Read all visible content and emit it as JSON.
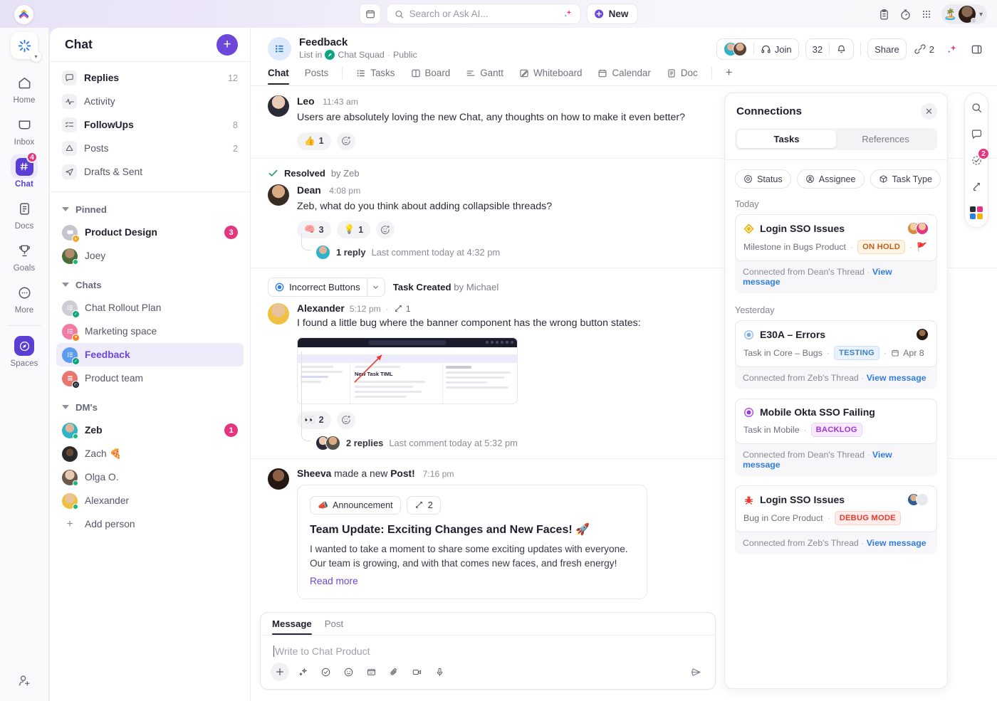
{
  "topbar": {
    "search_placeholder": "Search or Ask AI...",
    "new_label": "New",
    "icons": [
      "calendar-icon",
      "search-icon",
      "ai-sparkle-icon",
      "clipboard-icon",
      "timer-icon",
      "apps-grid-icon"
    ],
    "status_emoji": "🏝️"
  },
  "rail": {
    "items": [
      {
        "label": "Home",
        "icon": "home-icon",
        "badge": ""
      },
      {
        "label": "Inbox",
        "icon": "inbox-icon",
        "badge": ""
      },
      {
        "label": "Chat",
        "icon": "hash-icon",
        "badge": "4"
      },
      {
        "label": "Docs",
        "icon": "docs-icon",
        "badge": ""
      },
      {
        "label": "Goals",
        "icon": "trophy-icon",
        "badge": ""
      },
      {
        "label": "More",
        "icon": "more-dots-icon",
        "badge": ""
      },
      {
        "label": "Spaces",
        "icon": "compass-icon",
        "badge": ""
      }
    ],
    "invite_icon": "add-person-icon"
  },
  "sidebar": {
    "title": "Chat",
    "add_button": "+",
    "quick": [
      {
        "label": "Replies",
        "count": "12",
        "icon": "reply-bubble-icon",
        "bold": true
      },
      {
        "label": "Activity",
        "count": "",
        "icon": "activity-pulse-icon",
        "bold": false
      },
      {
        "label": "FollowUps",
        "count": "8",
        "icon": "checklist-icon",
        "bold": true
      },
      {
        "label": "Posts",
        "count": "2",
        "icon": "post-icon",
        "bold": false
      },
      {
        "label": "Drafts & Sent",
        "count": "",
        "icon": "send-icon",
        "bold": false
      }
    ],
    "sections": [
      {
        "name": "Pinned",
        "items": [
          {
            "label": "Product Design",
            "badge": "3",
            "bold": true,
            "kind": "chat",
            "color": "#b9b9c4",
            "corner": "#f5a623"
          },
          {
            "label": "Joey",
            "badge": "",
            "bold": false,
            "kind": "person",
            "color": "#7c9a6a",
            "online": true
          }
        ]
      },
      {
        "name": "Chats",
        "items": [
          {
            "label": "Chat Rollout Plan",
            "badge": "",
            "bold": false,
            "kind": "list",
            "color": "#c9c9d2",
            "corner": "#10a37f"
          },
          {
            "label": "Marketing space",
            "badge": "",
            "bold": false,
            "kind": "list",
            "color": "#f27ba6",
            "corner": "#f5821f"
          },
          {
            "label": "Feedback",
            "badge": "",
            "bold": false,
            "kind": "list",
            "color": "#5b9bf0",
            "corner": "#10a37f",
            "selected": true
          },
          {
            "label": "Product team",
            "badge": "",
            "bold": false,
            "kind": "list",
            "color": "#e8756e",
            "corner": "#1f1f2e"
          }
        ]
      },
      {
        "name": "DM's",
        "items": [
          {
            "label": "Zeb",
            "badge": "1",
            "bold": true,
            "kind": "person",
            "color": "#2fb3c9",
            "online": true
          },
          {
            "label": "Zach 🍕",
            "badge": "",
            "bold": false,
            "kind": "person",
            "color": "#3a3a3a",
            "online": false
          },
          {
            "label": "Olga O.",
            "badge": "",
            "bold": false,
            "kind": "person",
            "color": "#c8b6a6",
            "online": true
          },
          {
            "label": "Alexander",
            "badge": "",
            "bold": false,
            "kind": "person",
            "color": "#f0c040",
            "online": true
          }
        ]
      }
    ],
    "add_person": "Add person"
  },
  "channel": {
    "name": "Feedback",
    "breadcrumb_prefix": "List in",
    "space": "Chat Squad",
    "visibility": "Public",
    "separator": "·",
    "join_label": "Join",
    "notif_count": "32",
    "share_label": "Share",
    "connections_count": "2",
    "tabs": [
      {
        "label": "Chat",
        "active": true,
        "icon": ""
      },
      {
        "label": "Posts",
        "active": false,
        "icon": ""
      },
      {
        "label": "Tasks",
        "active": false,
        "icon": "list-icon"
      },
      {
        "label": "Board",
        "active": false,
        "icon": "board-icon"
      },
      {
        "label": "Gantt",
        "active": false,
        "icon": "gantt-icon"
      },
      {
        "label": "Whiteboard",
        "active": false,
        "icon": "whiteboard-icon"
      },
      {
        "label": "Calendar",
        "active": false,
        "icon": "calendar-icon"
      },
      {
        "label": "Doc",
        "active": false,
        "icon": "doc-icon"
      }
    ],
    "add_tab": "+"
  },
  "messages": [
    {
      "author": "Leo",
      "time": "11:43 am",
      "text": "Users are absolutely loving the new Chat, any thoughts on how to make it even better?",
      "avatar_color": "#d8c3ae",
      "reactions": [
        {
          "emoji": "👍",
          "count": "1"
        }
      ]
    },
    {
      "resolved_label": "Resolved",
      "resolved_by": "by Zeb",
      "author": "Dean",
      "time": "4:08 pm",
      "text": "Zeb, what do you think about adding collapsible threads?",
      "avatar_color": "#6b5141",
      "reactions": [
        {
          "emoji": "🧠",
          "count": "3"
        },
        {
          "emoji": "💡",
          "count": "1"
        }
      ],
      "thread": {
        "count": "1 reply",
        "meta": "Last comment today at 4:32 pm"
      }
    },
    {
      "task_chip": "Incorrect Buttons",
      "task_meta_bold": "Task Created",
      "task_meta_rest": "by Michael",
      "author": "Alexander",
      "time": "5:12 pm",
      "link_count": "1",
      "text": "I found a little bug where the banner component has the wrong button states:",
      "avatar_color": "#f0c040",
      "has_image": true,
      "reactions": [
        {
          "emoji": "👀",
          "count": "2"
        }
      ],
      "thread": {
        "count": "2 replies",
        "meta": "Last comment today at 5:32 pm"
      }
    },
    {
      "author": "Sheeva",
      "post_prefix": "made a new",
      "post_word": "Post!",
      "time": "7:16 pm",
      "avatar_color": "#3b2a22",
      "post": {
        "tag": "Announcement",
        "tag_emoji": "📣",
        "link_count": "2",
        "title": "Team Update: Exciting Changes and New Faces! 🚀",
        "body": "I wanted to take a moment to share some exciting updates with everyone. Our team is growing, and with that comes new faces, and fresh energy!",
        "read_more": "Read more"
      }
    }
  ],
  "composer": {
    "tabs": [
      {
        "label": "Message",
        "active": true
      },
      {
        "label": "Post",
        "active": false
      }
    ],
    "placeholder": "Write to Chat Product",
    "tools": [
      "plus-icon",
      "ai-sparkle-icon",
      "task-check-icon",
      "emoji-icon",
      "gif-icon",
      "attach-icon",
      "video-icon",
      "mic-icon"
    ],
    "send_icon": "send-icon"
  },
  "connections": {
    "title": "Connections",
    "close_icon": "close-icon",
    "tabs": [
      {
        "label": "Tasks",
        "active": true
      },
      {
        "label": "References",
        "active": false
      }
    ],
    "filters": [
      {
        "label": "Status",
        "icon": "status-circle-icon"
      },
      {
        "label": "Assignee",
        "icon": "assignee-icon"
      },
      {
        "label": "Task Type",
        "icon": "cube-icon"
      }
    ],
    "groups": [
      {
        "day": "Today",
        "cards": [
          {
            "title": "Login SSO Issues",
            "type_icon": "milestone-diamond-icon",
            "type_color": "#f2b307",
            "location": "Milestone in Bugs Product",
            "badge": "ON HOLD",
            "badge_color": "#c0621a",
            "badge_bg": "#fdf3e4",
            "badge_border": "#f3ddb8",
            "flag": "🚩",
            "date": "",
            "avatars": [
              "#e09b5b",
              "#e5357f"
            ],
            "footer": "Connected from Dean's Thread",
            "footer_sep": "·",
            "link": "View message"
          }
        ]
      },
      {
        "day": "Yesterday",
        "cards": [
          {
            "title": "E30A – Errors",
            "type_icon": "task-circle-icon",
            "type_color": "#7aa9e8",
            "location": "Task in Core – Bugs",
            "badge": "TESTING",
            "badge_color": "#3b7fc4",
            "badge_bg": "#eaf3fc",
            "badge_border": "#c8e0f6",
            "date": "Apr 8",
            "date_icon": "calendar-icon",
            "avatars": [
              "#4a3728"
            ],
            "footer": "Connected from Zeb's Thread",
            "footer_sep": "·",
            "link": "View message"
          },
          {
            "title": "Mobile Okta SSO Failing",
            "type_icon": "task-circle-icon",
            "type_color": "#a033d8",
            "location": "Task in Mobile",
            "badge": "BACKLOG",
            "badge_color": "#a033d8",
            "badge_bg": "#f8eafd",
            "badge_border": "#ecd2f8",
            "date": "",
            "avatars": [],
            "footer": "Connected from Dean's Thread",
            "footer_sep": "·",
            "link": "View message"
          },
          {
            "title": "Login SSO Issues",
            "type_icon": "bug-icon",
            "type_color": "#e8392f",
            "location": "Bug in Core Product",
            "badge": "DEBUG MODE",
            "badge_color": "#e03a2f",
            "badge_bg": "#fdecea",
            "badge_border": "#f8cfca",
            "date": "",
            "avatars": [
              "#3f6fa8",
              "#b9b9c4"
            ],
            "footer": "Connected from Zeb's Thread",
            "footer_sep": "·",
            "link": "View message"
          }
        ]
      }
    ]
  },
  "right_rail": {
    "items": [
      {
        "icon": "search-icon",
        "badge": ""
      },
      {
        "icon": "comment-icon",
        "badge": ""
      },
      {
        "icon": "task-check-dashed-icon",
        "badge": "2"
      },
      {
        "icon": "relationships-arrows-icon",
        "badge": ""
      },
      {
        "icon": "apps-color-grid-icon",
        "badge": ""
      }
    ]
  }
}
